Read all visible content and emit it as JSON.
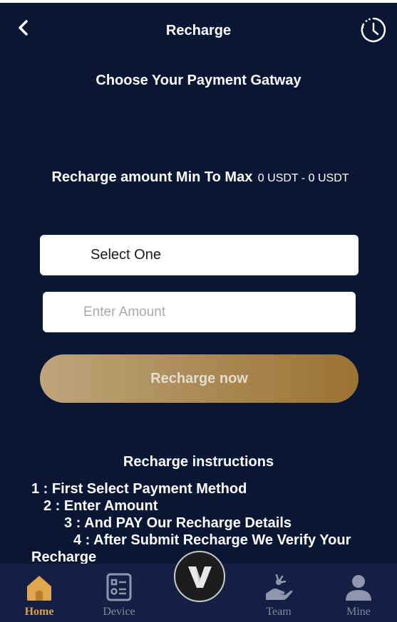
{
  "header": {
    "title": "Recharge",
    "back_icon": "chevron-left-icon",
    "history_icon": "history-clock-icon"
  },
  "main": {
    "gateway_heading": "Choose Your Payment Gatway",
    "range_label": "Recharge amount Min To Max",
    "range_values": "0 USDT - 0 USDT",
    "select": {
      "selected": "Select One"
    },
    "amount": {
      "value": "",
      "placeholder": "Enter Amount"
    },
    "submit_label": "Recharge now"
  },
  "instructions": {
    "title": "Recharge instructions",
    "steps": [
      "1 : First Select Payment Method",
      "2 : Enter Amount",
      "3 : And PAY Our Recharge Details",
      "4 : After Submit Recharge We Verify Your",
      "Recharge"
    ]
  },
  "nav": {
    "items": [
      {
        "label": "Home",
        "icon": "home-icon",
        "active": true
      },
      {
        "label": "Device",
        "icon": "device-icon",
        "active": false
      },
      {
        "label": "Team",
        "icon": "team-icon",
        "active": false
      },
      {
        "label": "Mine",
        "icon": "user-icon",
        "active": false
      }
    ],
    "center_icon": "v-logo-icon"
  },
  "colors": {
    "background": "#0a1734",
    "nav_background": "#151f43",
    "accent_gold": "#d3a34b",
    "button_gradient_start": "#bfa479",
    "button_gradient_end": "#9c7331",
    "nav_inactive": "#7d879f"
  }
}
